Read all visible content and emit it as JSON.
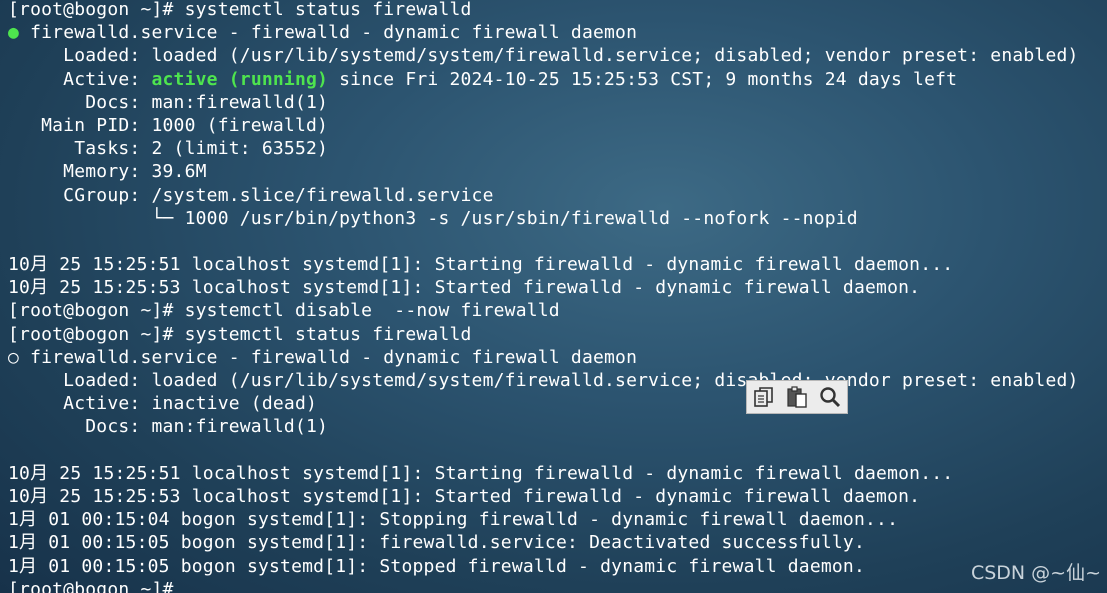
{
  "terminal": {
    "lines": [
      "[root@bogon ~]# systemctl status firewalld",
      "firewalld.service - firewalld - dynamic firewall daemon",
      "     Loaded: loaded (/usr/lib/systemd/system/firewalld.service; disabled; vendor preset: enabled)",
      "active (running)",
      "       Docs: man:firewalld(1)",
      "   Main PID: 1000 (firewalld)",
      "      Tasks: 2 (limit: 63552)",
      "     Memory: 39.6M",
      "     CGroup: /system.slice/firewalld.service",
      "             └─ 1000 /usr/bin/python3 -s /usr/sbin/firewalld --nofork --nopid",
      "",
      "10月 25 15:25:51 localhost systemd[1]: Starting firewalld - dynamic firewall daemon...",
      "10月 25 15:25:53 localhost systemd[1]: Started firewalld - dynamic firewall daemon.",
      "[root@bogon ~]# systemctl disable  --now firewalld",
      "[root@bogon ~]# systemctl status firewalld",
      "firewalld.service - firewalld - dynamic firewall daemon",
      "     Loaded: loaded (/usr/lib/systemd/system/firewalld.service; disabled; vendor preset: enabled)",
      "     Active: inactive (dead)",
      "       Docs: man:firewalld(1)",
      "",
      "10月 25 15:25:51 localhost systemd[1]: Starting firewalld - dynamic firewall daemon...",
      "10月 25 15:25:53 localhost systemd[1]: Started firewalld - dynamic firewall daemon.",
      "1月 01 00:15:04 bogon systemd[1]: Stopping firewalld - dynamic firewall daemon...",
      "1月 01 00:15:05 bogon systemd[1]: firewalld.service: Deactivated successfully.",
      "1月 01 00:15:05 bogon systemd[1]: Stopped firewalld - dynamic firewall daemon.",
      "[root@bogon ~]#"
    ],
    "active_prefix": "     Active: ",
    "active_suffix": " since Fri 2024-10-25 15:25:53 CST; 9 months 24 days left",
    "dot_active": "●",
    "dot_inactive": "○"
  },
  "toolbar": {
    "icons": [
      "copy-icon",
      "paste-icon",
      "search-icon"
    ]
  },
  "watermark": "CSDN @~仙~",
  "colors": {
    "running": "#4ee44e",
    "text": "#ffffff",
    "background": "#2c5470"
  }
}
